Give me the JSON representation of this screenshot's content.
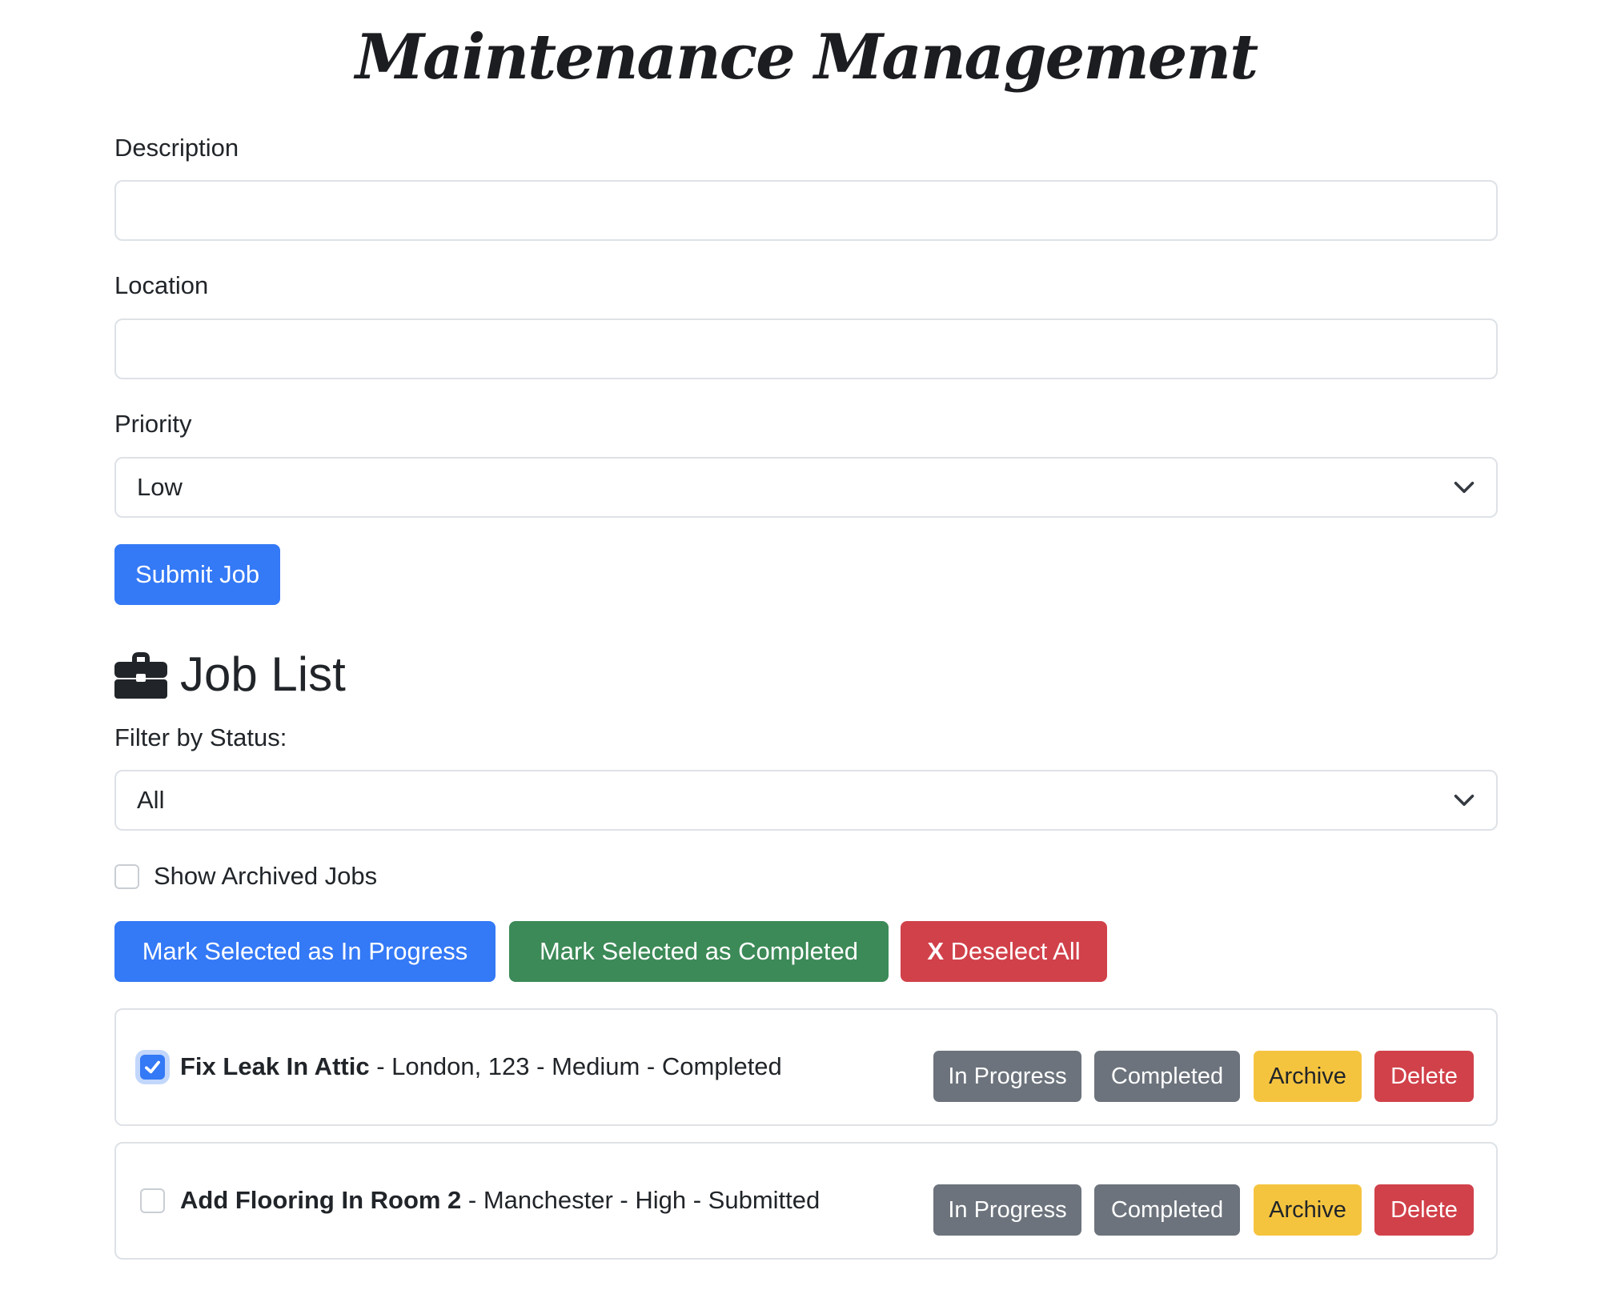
{
  "app": {
    "title": "Maintenance Management"
  },
  "form": {
    "description_label": "Description",
    "description_value": "",
    "location_label": "Location",
    "location_value": "",
    "priority_label": "Priority",
    "priority_selected": "Low",
    "submit_label": "Submit Job"
  },
  "job_list": {
    "heading": "Job List",
    "filter_label": "Filter by Status:",
    "filter_selected": "All",
    "show_archived_label": "Show Archived Jobs",
    "show_archived_checked": false,
    "bulk_in_progress_label": "Mark Selected as In Progress",
    "bulk_completed_label": "Mark Selected as Completed",
    "deselect_icon": "X",
    "deselect_label": " Deselect All",
    "jobs": [
      {
        "title": "Fix Leak In Attic",
        "details": " - London, 123 - Medium - Completed",
        "checked": true,
        "in_progress_label": "In Progress",
        "completed_label": "Completed",
        "archive_label": "Archive",
        "delete_label": "Delete"
      },
      {
        "title": "Add Flooring In Room 2",
        "details": " - Manchester - High - Submitted",
        "checked": false,
        "in_progress_label": "In Progress",
        "completed_label": "Completed",
        "archive_label": "Archive",
        "delete_label": "Delete"
      }
    ]
  },
  "colors": {
    "primary": "#3479f6",
    "success": "#3c8a57",
    "danger": "#d1414a",
    "secondary": "#6c737c",
    "warning": "#f5c43f"
  }
}
